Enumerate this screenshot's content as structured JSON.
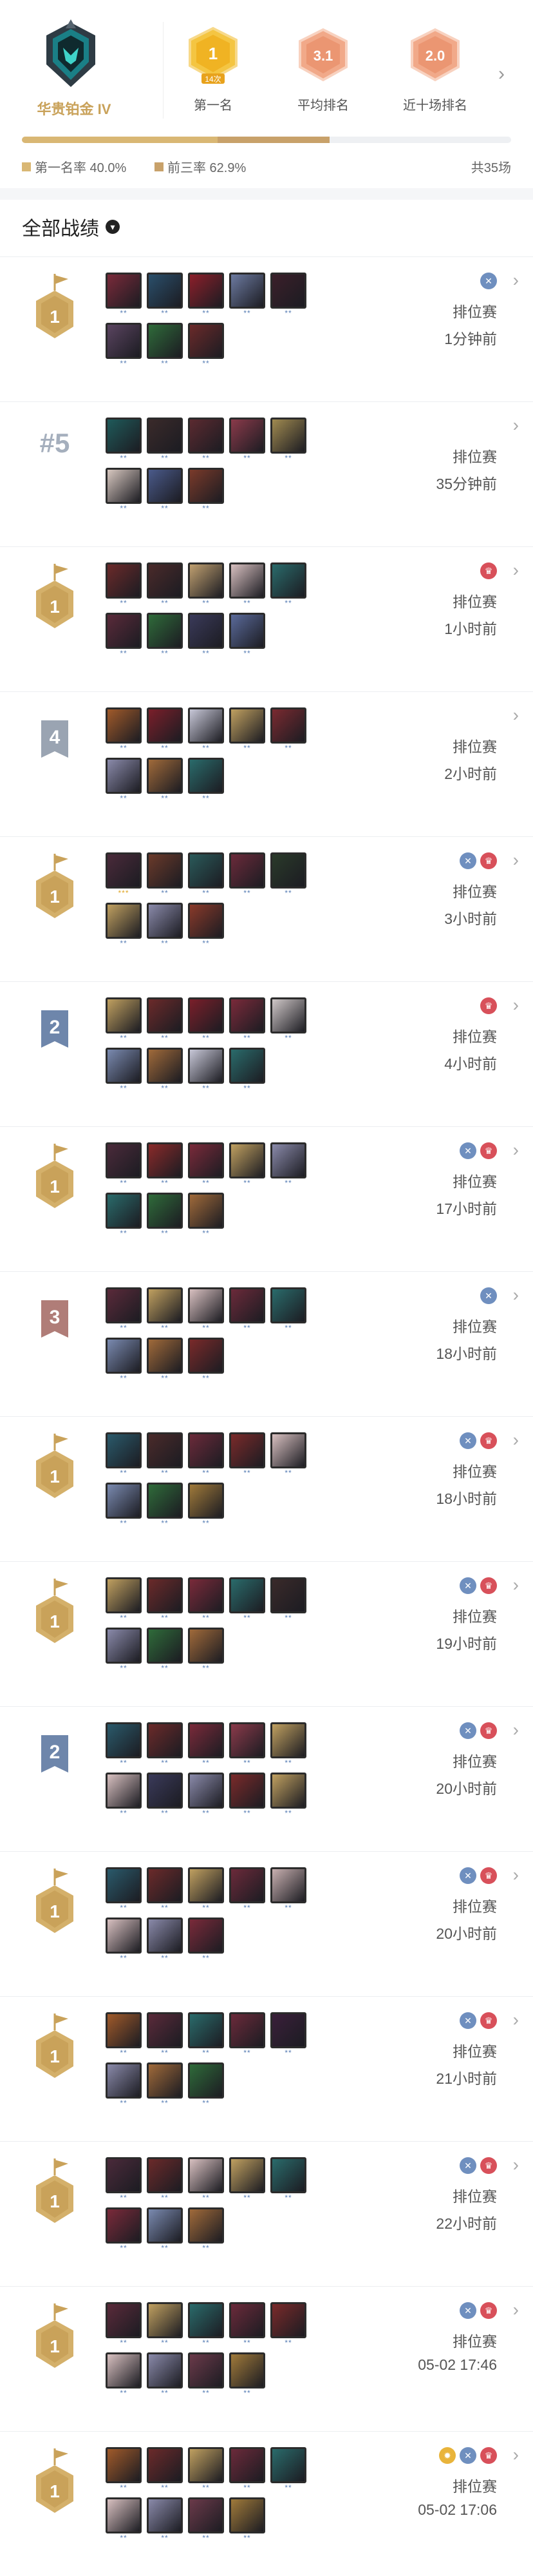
{
  "header": {
    "rank_name": "华贵铂金 IV",
    "stats": [
      {
        "value": "1",
        "sub": "14次",
        "label": "第一名",
        "style": "gold"
      },
      {
        "value": "3.1",
        "sub": "",
        "label": "平均排名",
        "style": "copper"
      },
      {
        "value": "2.0",
        "sub": "",
        "label": "近十场排名",
        "style": "copper"
      }
    ],
    "first_rate_label": "第一名率 40.0%",
    "top3_rate_label": "前三率 62.9%",
    "first_rate": 0.4,
    "top3_rate": 0.629,
    "total_label": "共35场",
    "colors": {
      "first": "#d9b774",
      "top3": "#c8a16a",
      "gold": "#c9a25a"
    }
  },
  "section_title": "全部战绩",
  "matches": [
    {
      "place": "1",
      "placeStyle": "gold",
      "mode": "排位赛",
      "time": "1分钟前",
      "tags": [
        "x"
      ],
      "champs": [
        [
          "#7a2a3a",
          "**"
        ],
        [
          "#2a4f6b",
          "**"
        ],
        [
          "#8c1f2a",
          "**"
        ],
        [
          "#6c7aa0",
          "**"
        ],
        [
          "#3b1f2a",
          "**"
        ],
        [
          "#5a4460",
          "**"
        ],
        [
          "#2f6b3a",
          "**"
        ],
        [
          "#6b2a2a",
          "**"
        ]
      ]
    },
    {
      "place": "#5",
      "placeStyle": "plain",
      "mode": "排位赛",
      "time": "35分钟前",
      "tags": [],
      "champs": [
        [
          "#1f5a5a",
          "**"
        ],
        [
          "#3a2a2a",
          "**"
        ],
        [
          "#5b2a30",
          "**"
        ],
        [
          "#8a3a4a",
          "**"
        ],
        [
          "#a08a50",
          "**"
        ],
        [
          "#d8c8c0",
          "**"
        ],
        [
          "#4a5a8a",
          "**"
        ],
        [
          "#7a3a2a",
          "**"
        ]
      ]
    },
    {
      "place": "1",
      "placeStyle": "gold",
      "mode": "排位赛",
      "time": "1小时前",
      "tags": [
        "crown"
      ],
      "champs": [
        [
          "#6b2a2a",
          "**"
        ],
        [
          "#4a2a2a",
          "**"
        ],
        [
          "#c0a070",
          "**"
        ],
        [
          "#d8c0c0",
          "**"
        ],
        [
          "#2a6b6b",
          "**"
        ],
        [
          "#5a2a3a",
          "**"
        ],
        [
          "#2f6b3a",
          "**"
        ],
        [
          "#3a3a5a",
          "**"
        ],
        [
          "#5a6a9a",
          "**"
        ]
      ]
    },
    {
      "place": "4",
      "placeStyle": "silver",
      "mode": "排位赛",
      "time": "2小时前",
      "tags": [],
      "champs": [
        [
          "#a05a2a",
          "**"
        ],
        [
          "#7a1f2a",
          "**"
        ],
        [
          "#c8c8d8",
          "**"
        ],
        [
          "#c0a060",
          "**"
        ],
        [
          "#7a2a30",
          "**"
        ],
        [
          "#8a8aaa",
          "**"
        ],
        [
          "#a06a3a",
          "**"
        ],
        [
          "#2a6b6b",
          "**"
        ]
      ]
    },
    {
      "place": "1",
      "placeStyle": "gold",
      "mode": "排位赛",
      "time": "3小时前",
      "tags": [
        "x",
        "crown"
      ],
      "champs": [
        [
          "#4a2a3a",
          "***"
        ],
        [
          "#6b3a2a",
          "**"
        ],
        [
          "#2a5a5a",
          "**"
        ],
        [
          "#6b2a3a",
          "**"
        ],
        [
          "#2a3a2a",
          "**"
        ],
        [
          "#c0a060",
          "**"
        ],
        [
          "#8a8aaa",
          "**"
        ],
        [
          "#8a3a2a",
          "**"
        ]
      ]
    },
    {
      "place": "2",
      "placeStyle": "blue",
      "mode": "排位赛",
      "time": "4小时前",
      "tags": [
        "crown"
      ],
      "champs": [
        [
          "#c0a060",
          "**"
        ],
        [
          "#6b2a2a",
          "**"
        ],
        [
          "#7a1f2a",
          "**"
        ],
        [
          "#7a2a3a",
          "**"
        ],
        [
          "#d0c8c8",
          "**"
        ],
        [
          "#7a8ab0",
          "**"
        ],
        [
          "#a06a3a",
          "**"
        ],
        [
          "#c8c8d8",
          "**"
        ],
        [
          "#2a6b6b",
          "**"
        ]
      ]
    },
    {
      "place": "1",
      "placeStyle": "gold",
      "mode": "排位赛",
      "time": "17小时前",
      "tags": [
        "x",
        "crown"
      ],
      "champs": [
        [
          "#4a2a3a",
          "**"
        ],
        [
          "#8a2a2a",
          "**"
        ],
        [
          "#7a2a3a",
          "**"
        ],
        [
          "#c0a060",
          "**"
        ],
        [
          "#8a8aaa",
          "**"
        ],
        [
          "#2a6b6b",
          "**"
        ],
        [
          "#2f6b3a",
          "**"
        ],
        [
          "#a06a3a",
          "**"
        ]
      ]
    },
    {
      "place": "3",
      "placeStyle": "bronze",
      "mode": "排位赛",
      "time": "18小时前",
      "tags": [
        "x"
      ],
      "champs": [
        [
          "#5a2a3a",
          "**"
        ],
        [
          "#c0a060",
          "**"
        ],
        [
          "#d8c0c0",
          "**"
        ],
        [
          "#6b2a3a",
          "**"
        ],
        [
          "#2a6b6b",
          "**"
        ],
        [
          "#7a8ab0",
          "**"
        ],
        [
          "#a06a3a",
          "**"
        ],
        [
          "#7a2a2a",
          "**"
        ]
      ]
    },
    {
      "place": "1",
      "placeStyle": "gold",
      "mode": "排位赛",
      "time": "18小时前",
      "tags": [
        "x",
        "crown"
      ],
      "champs": [
        [
          "#2a5a6b",
          "**"
        ],
        [
          "#4a2a2a",
          "**"
        ],
        [
          "#6b2a3a",
          "**"
        ],
        [
          "#7a2a2a",
          "**"
        ],
        [
          "#d8c0c0",
          "**"
        ],
        [
          "#7a8ab0",
          "**"
        ],
        [
          "#2f6b3a",
          "**"
        ],
        [
          "#a07a3a",
          "**"
        ]
      ]
    },
    {
      "place": "1",
      "placeStyle": "gold",
      "mode": "排位赛",
      "time": "19小时前",
      "tags": [
        "x",
        "crown"
      ],
      "champs": [
        [
          "#c0a060",
          "**"
        ],
        [
          "#6b2a2a",
          "**"
        ],
        [
          "#7a2a3a",
          "**"
        ],
        [
          "#2a6b6b",
          "**"
        ],
        [
          "#3a2a2a",
          "**"
        ],
        [
          "#8a8aaa",
          "**"
        ],
        [
          "#2f6b3a",
          "**"
        ],
        [
          "#a06a3a",
          "**"
        ]
      ]
    },
    {
      "place": "2",
      "placeStyle": "blue",
      "mode": "排位赛",
      "time": "20小时前",
      "tags": [
        "x",
        "crown"
      ],
      "champs": [
        [
          "#2a5a6b",
          "**"
        ],
        [
          "#6b2a2a",
          "**"
        ],
        [
          "#7a2a3a",
          "**"
        ],
        [
          "#8a3a4a",
          "**"
        ],
        [
          "#c0a060",
          "**"
        ],
        [
          "#d8c0c0",
          "**"
        ],
        [
          "#3a3a5a",
          "**"
        ],
        [
          "#8a8aaa",
          "**"
        ],
        [
          "#7a2a2a",
          "**"
        ],
        [
          "#c0a060",
          "**"
        ]
      ]
    },
    {
      "place": "1",
      "placeStyle": "gold",
      "mode": "排位赛",
      "time": "20小时前",
      "tags": [
        "x",
        "crown"
      ],
      "champs": [
        [
          "#2a5a6b",
          "**"
        ],
        [
          "#6b2a2a",
          "**"
        ],
        [
          "#c0a060",
          "**"
        ],
        [
          "#6b2a3a",
          "**"
        ],
        [
          "#c8b0b0",
          "**"
        ],
        [
          "#d8c0c0",
          "**"
        ],
        [
          "#8a8aaa",
          "**"
        ],
        [
          "#7a2a3a",
          "**"
        ]
      ]
    },
    {
      "place": "1",
      "placeStyle": "gold",
      "mode": "排位赛",
      "time": "21小时前",
      "tags": [
        "x",
        "crown"
      ],
      "champs": [
        [
          "#a05a2a",
          "**"
        ],
        [
          "#5a2a3a",
          "**"
        ],
        [
          "#2a6b6b",
          "**"
        ],
        [
          "#6b2a3a",
          "**"
        ],
        [
          "#3a1f3a",
          "**"
        ],
        [
          "#8a8aaa",
          "**"
        ],
        [
          "#a06a3a",
          "**"
        ],
        [
          "#2f6b3a",
          "**"
        ]
      ]
    },
    {
      "place": "1",
      "placeStyle": "gold",
      "mode": "排位赛",
      "time": "22小时前",
      "tags": [
        "x",
        "crown"
      ],
      "champs": [
        [
          "#4a2a3a",
          "**"
        ],
        [
          "#6b2a2a",
          "**"
        ],
        [
          "#d8c0c0",
          "**"
        ],
        [
          "#c0a060",
          "**"
        ],
        [
          "#2a6b6b",
          "**"
        ],
        [
          "#7a2a3a",
          "**"
        ],
        [
          "#7a8ab0",
          "**"
        ],
        [
          "#a06a3a",
          "**"
        ]
      ]
    },
    {
      "place": "1",
      "placeStyle": "gold",
      "mode": "排位赛",
      "time": "05-02 17:46",
      "tags": [
        "x",
        "crown"
      ],
      "champs": [
        [
          "#5a2a3a",
          "**"
        ],
        [
          "#c0a060",
          "**"
        ],
        [
          "#2a6b6b",
          "**"
        ],
        [
          "#6b2a3a",
          "**"
        ],
        [
          "#7a2a2a",
          "**"
        ],
        [
          "#d8c0c0",
          "**"
        ],
        [
          "#8a8aaa",
          "**"
        ],
        [
          "#6b3a4a",
          "**"
        ],
        [
          "#a07a3a",
          "**"
        ]
      ]
    },
    {
      "place": "1",
      "placeStyle": "gold",
      "mode": "排位赛",
      "time": "05-02 17:06",
      "tags": [
        "sun",
        "x",
        "crown"
      ],
      "champs": [
        [
          "#a05a2a",
          "**"
        ],
        [
          "#6b2a2a",
          "**"
        ],
        [
          "#c0a060",
          "**"
        ],
        [
          "#6b2a3a",
          "**"
        ],
        [
          "#2a6b6b",
          "**"
        ],
        [
          "#d8c0c0",
          "**"
        ],
        [
          "#8a8aaa",
          "**"
        ],
        [
          "#6b3a4a",
          "**"
        ],
        [
          "#a07a3a",
          "**"
        ]
      ]
    }
  ]
}
